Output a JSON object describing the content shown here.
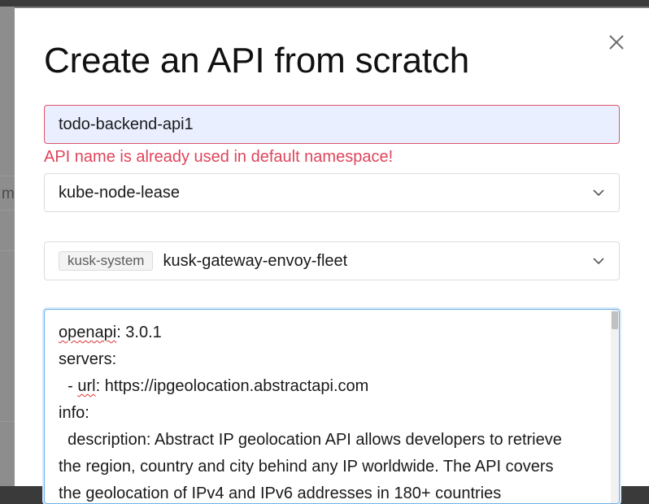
{
  "modal": {
    "title": "Create an API from scratch",
    "close_icon": "close-icon"
  },
  "form": {
    "api_name_value": "todo-backend-api1",
    "api_name_error": "API name is already used in default namespace!",
    "namespace_select_value": "kube-node-lease",
    "namespace_chevron_icon": "chevron-down-icon",
    "envoy_fleet_tag": "kusk-system",
    "envoy_fleet_value": "kusk-gateway-envoy-fleet",
    "envoy_chevron_icon": "chevron-down-icon"
  },
  "editor": {
    "lines": [
      {
        "key": "openapi",
        "rest": ": 3.0.1"
      },
      {
        "key": "",
        "rest": "servers:"
      },
      {
        "prefix": "  - ",
        "key": "url",
        "rest": ": https://ipgeolocation.abstractapi.com"
      },
      {
        "key": "",
        "rest": "info:"
      },
      {
        "key": "",
        "rest": "  description: Abstract IP geolocation API allows developers to retrieve"
      },
      {
        "key": "",
        "rest": "the region, country and city behind any IP worldwide. The API covers"
      },
      {
        "key": "",
        "rest": "the geolocation of IPv4 and IPv6 addresses in 180+ countries"
      }
    ]
  },
  "colors": {
    "error": "#e0445b",
    "input_bg": "#e9efff",
    "focus_border": "#6fb0e6"
  }
}
